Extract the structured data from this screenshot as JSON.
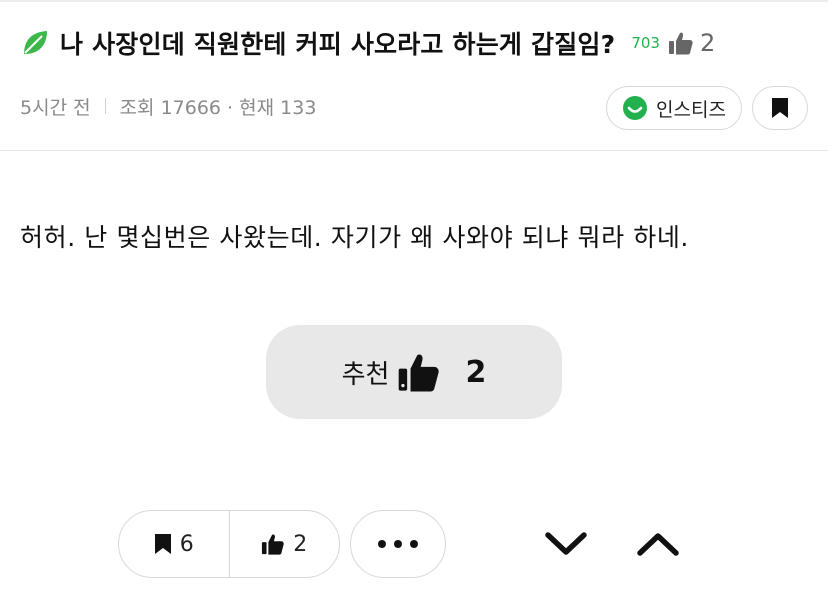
{
  "post": {
    "title": "나 사장인데 직원한테 커피 사오라고 하는게 갑질임?",
    "views_small": "703",
    "title_likes": "2",
    "meta": {
      "time": "5시간 전",
      "views": "조회 17666 · 현재 133"
    },
    "channel": "인스티즈",
    "body": "허허. 난 몇십번은 사왔는데. 자기가 왜 사와야 되냐 뭐라 하네."
  },
  "recommend": {
    "label": "추천",
    "count": "2"
  },
  "actions": {
    "bookmark_count": "6",
    "like_count": "2"
  },
  "colors": {
    "accent_green": "#22b14c",
    "button_gray": "#e8e8e8"
  },
  "icons": [
    "leaf-icon",
    "thumbs-up-icon",
    "smile-icon",
    "bookmark-icon",
    "more-icon",
    "chevron-down-icon",
    "chevron-up-icon"
  ]
}
